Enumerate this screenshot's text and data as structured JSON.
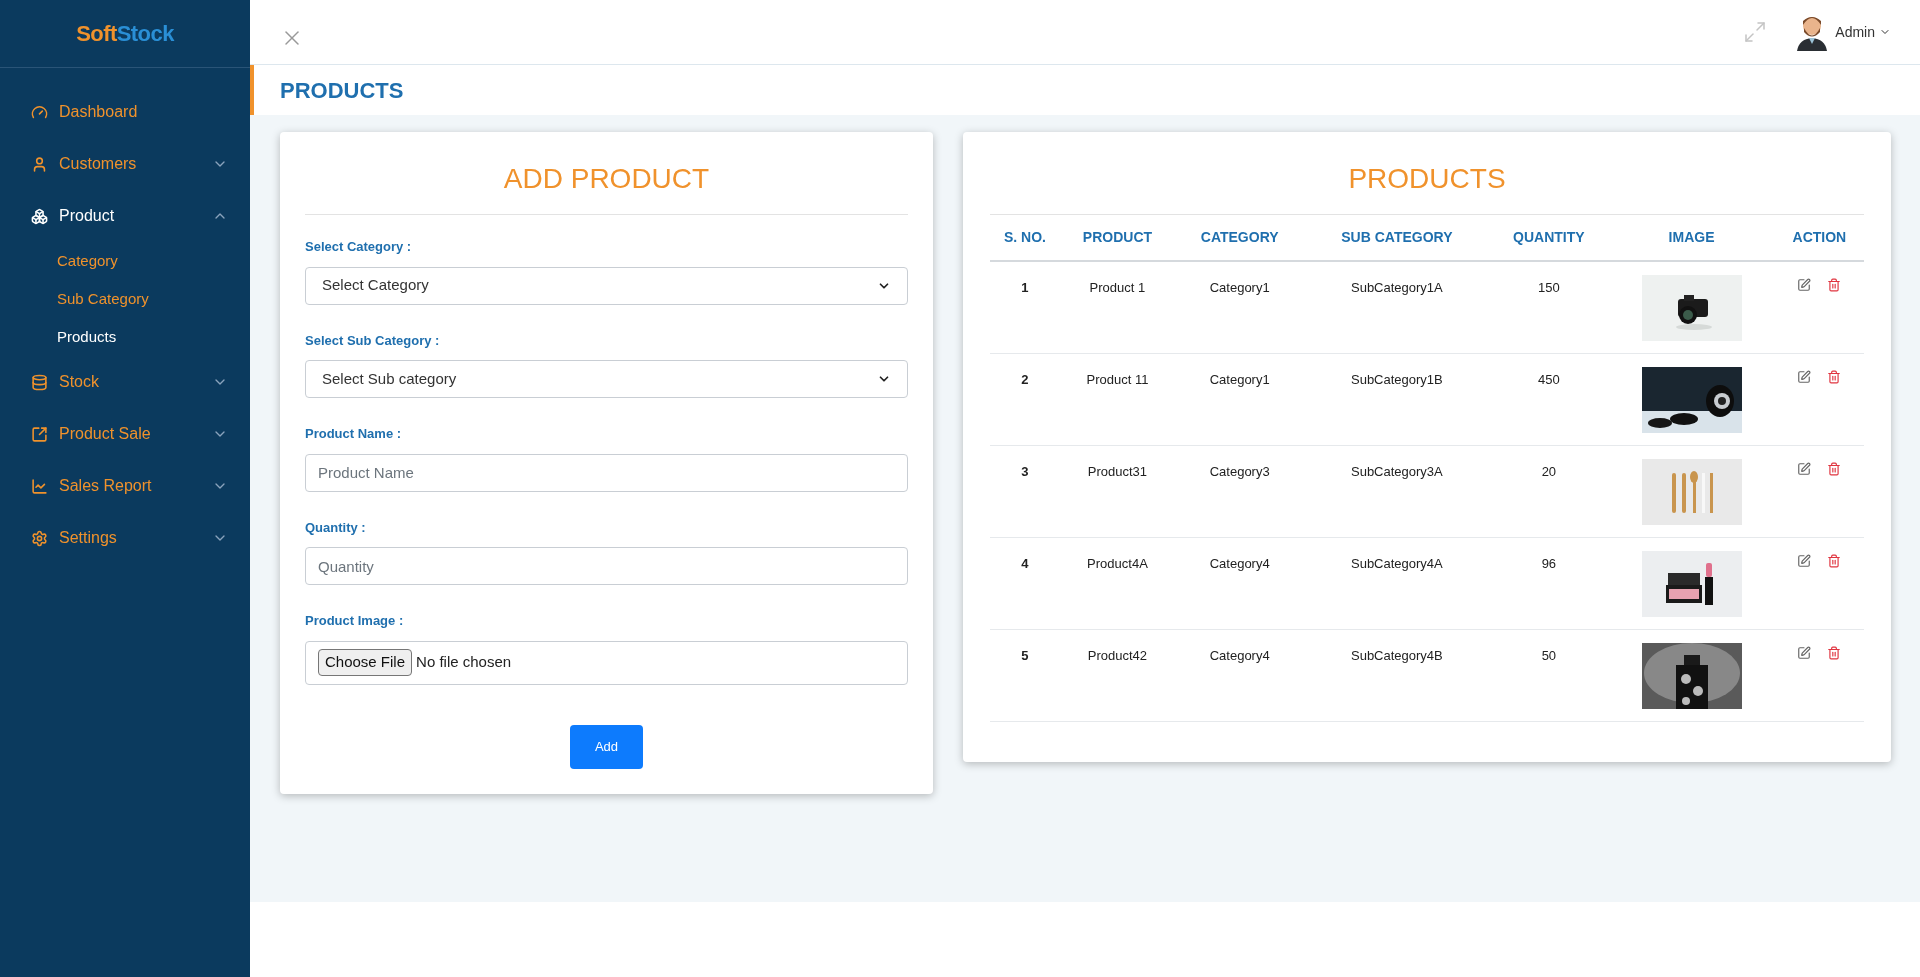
{
  "logo": {
    "part_1": "Soft",
    "part_2": "Stock"
  },
  "sidebar": {
    "items": [
      {
        "label": "Dashboard",
        "selected": false
      },
      {
        "label": "Customers",
        "expanded": false,
        "selected": false
      },
      {
        "label": "Product",
        "expanded": true,
        "selected": true,
        "children": [
          {
            "label": "Category",
            "selected": false
          },
          {
            "label": "Sub Category",
            "selected": false
          },
          {
            "label": "Products",
            "selected": true
          }
        ]
      },
      {
        "label": "Stock",
        "expanded": false,
        "selected": false
      },
      {
        "label": "Product Sale",
        "expanded": false,
        "selected": false
      },
      {
        "label": "Sales Report",
        "expanded": false,
        "selected": false
      },
      {
        "label": "Settings",
        "expanded": false,
        "selected": false
      }
    ]
  },
  "header": {
    "user": "Admin"
  },
  "page_title": "PRODUCTS",
  "form": {
    "title": "ADD PRODUCT",
    "fields": [
      {
        "kind": "select",
        "label": "Select Category :",
        "value": "Select Category"
      },
      {
        "kind": "select",
        "label": "Select Sub Category :",
        "value": "Select Sub category"
      },
      {
        "kind": "text",
        "label": "Product Name :",
        "placeholder": "Product Name"
      },
      {
        "kind": "text",
        "label": "Quantity :",
        "placeholder": "Quantity"
      },
      {
        "kind": "file",
        "label": "Product Image :",
        "button": "Choose File",
        "status": "No file chosen"
      }
    ],
    "submit": "Add"
  },
  "table": {
    "title": "PRODUCTS",
    "columns": [
      "S. NO.",
      "PRODUCT",
      "CATEGORY",
      "SUB CATEGORY",
      "QUANTITY",
      "IMAGE",
      "ACTION"
    ],
    "rows": [
      {
        "cells": [
          "1",
          "Product 1",
          "Category1",
          "SubCategory1A",
          "150"
        ]
      },
      {
        "cells": [
          "2",
          "Product 11",
          "Category1",
          "SubCategory1B",
          "450"
        ]
      },
      {
        "cells": [
          "3",
          "Product31",
          "Category3",
          "SubCategory3A",
          "20"
        ]
      },
      {
        "cells": [
          "4",
          "Product4A",
          "Category4",
          "SubCategory4A",
          "96"
        ]
      },
      {
        "cells": [
          "5",
          "Product42",
          "Category4",
          "SubCategory4B",
          "50"
        ]
      }
    ]
  }
}
